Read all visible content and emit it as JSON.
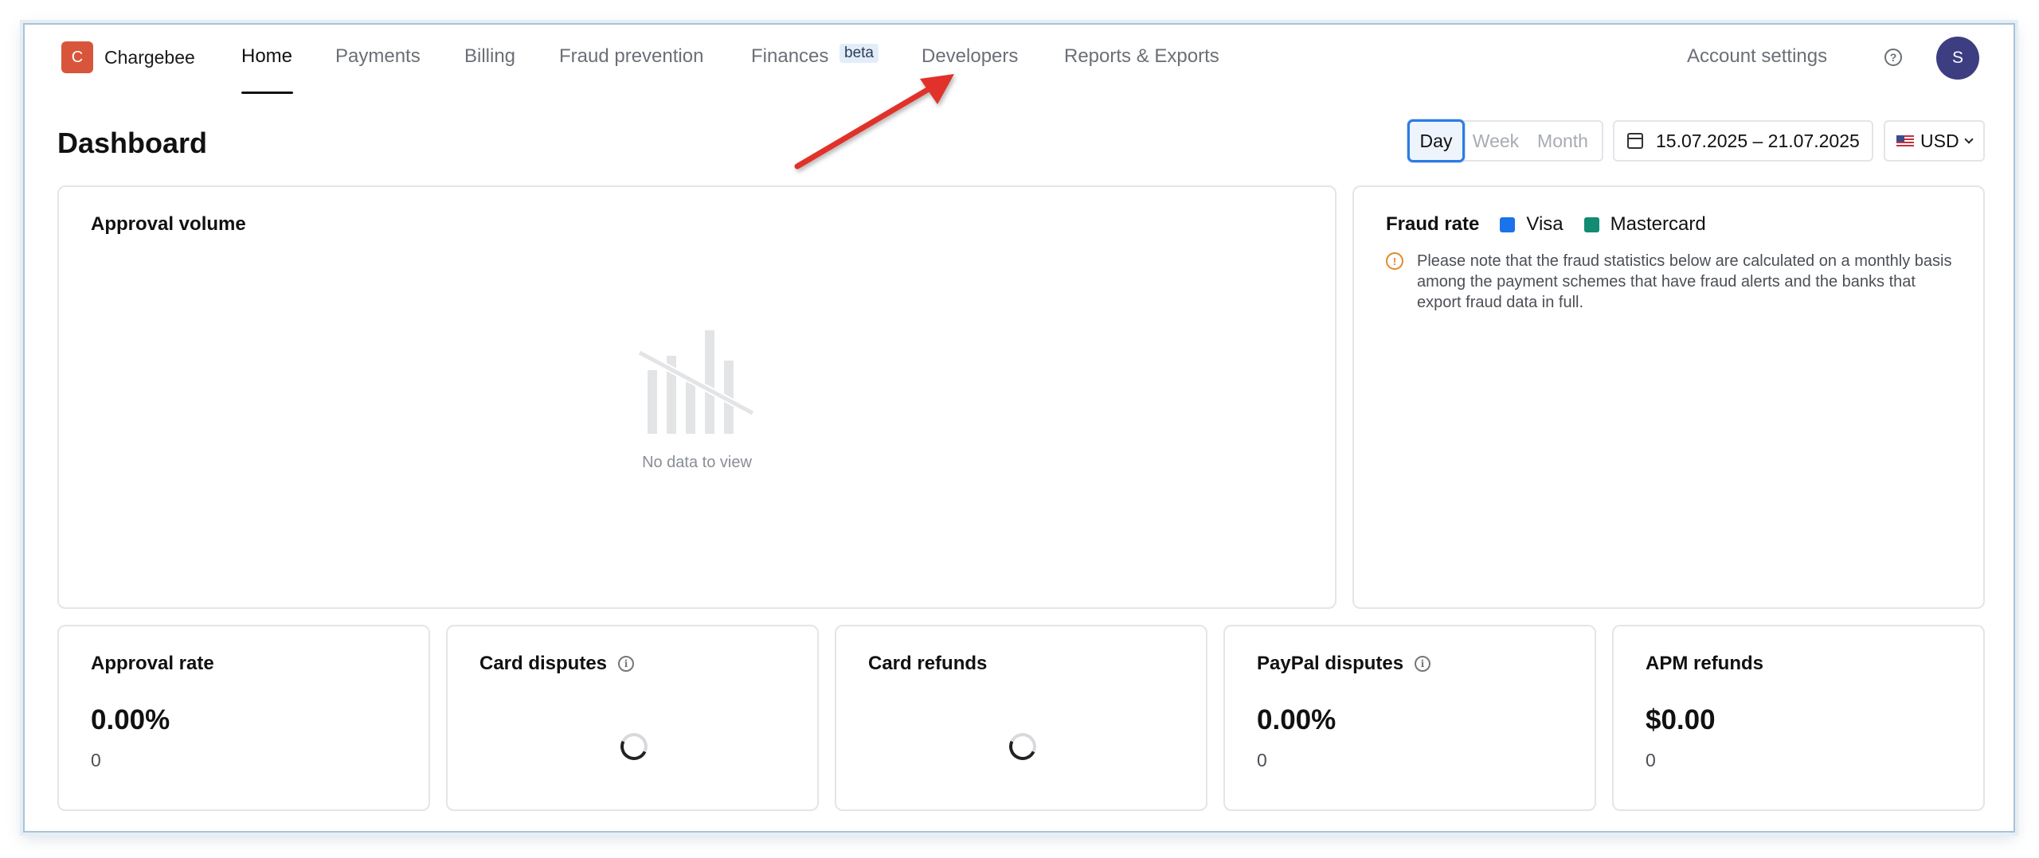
{
  "brand": {
    "logo_letter": "C",
    "name": "Chargebee"
  },
  "nav": {
    "items": [
      {
        "label": "Home",
        "active": true
      },
      {
        "label": "Payments"
      },
      {
        "label": "Billing"
      },
      {
        "label": "Fraud prevention"
      },
      {
        "label": "Finances",
        "badge": "beta"
      },
      {
        "label": "Developers"
      },
      {
        "label": "Reports & Exports"
      }
    ],
    "account_settings": "Account settings",
    "avatar_initial": "S"
  },
  "page": {
    "title": "Dashboard"
  },
  "filters": {
    "periods": [
      "Day",
      "Week",
      "Month"
    ],
    "selected_period": "Day",
    "date_range": "15.07.2025 – 21.07.2025",
    "currency": "USD"
  },
  "approval_volume": {
    "title": "Approval volume",
    "empty_text": "No data to view"
  },
  "fraud_rate": {
    "title": "Fraud rate",
    "legend": [
      {
        "name": "Visa",
        "color": "#1a73e8"
      },
      {
        "name": "Mastercard",
        "color": "#138a72"
      }
    ],
    "notice": "Please note that the fraud statistics below are calculated on a monthly basis among the payment schemes that have fraud alerts and the banks that export fraud data in full."
  },
  "metrics": [
    {
      "title": "Approval rate",
      "value": "0.00%",
      "sub": "0"
    },
    {
      "title": "Card disputes",
      "loading": true,
      "info": true
    },
    {
      "title": "Card refunds",
      "loading": true
    },
    {
      "title": "PayPal disputes",
      "value": "0.00%",
      "sub": "0",
      "info": true
    },
    {
      "title": "APM refunds",
      "value": "$0.00",
      "sub": "0"
    }
  ],
  "colors": {
    "accent": "#2c7be5",
    "brand": "#d8553b",
    "avatar": "#3d3d82",
    "annotation_arrow": "#e0302a"
  }
}
